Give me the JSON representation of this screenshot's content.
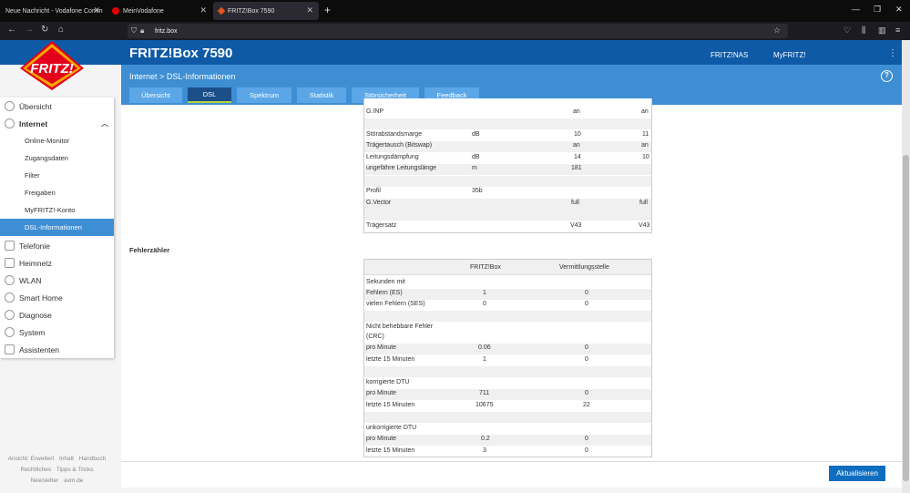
{
  "browser": {
    "tabs": [
      {
        "title": "Neue Nachricht - Vodafone Comm",
        "active": false
      },
      {
        "title": "MeinVodafone",
        "active": false
      },
      {
        "title": "FRITZ!Box 7590",
        "active": true
      }
    ],
    "url": "fritz.box"
  },
  "header": {
    "logo_text": "FRITZ!",
    "title": "FRITZ!Box 7590",
    "links": [
      "FRITZ!NAS",
      "MyFRITZ!"
    ]
  },
  "breadcrumb": {
    "parent": "Internet",
    "separator": ">",
    "current": "DSL-Informationen"
  },
  "page_tabs": [
    {
      "label": "Übersicht",
      "active": false
    },
    {
      "label": "DSL",
      "active": true
    },
    {
      "label": "Spektrum",
      "active": false
    },
    {
      "label": "Statistik",
      "active": false
    },
    {
      "label": "Störsicherheit",
      "active": false
    },
    {
      "label": "Feedback",
      "active": false
    }
  ],
  "sidebar": {
    "items": [
      {
        "label": "Übersicht"
      },
      {
        "label": "Internet"
      },
      {
        "label": "Online-Monitor"
      },
      {
        "label": "Zugangsdaten"
      },
      {
        "label": "Filter"
      },
      {
        "label": "Freigaben"
      },
      {
        "label": "MyFRITZ!-Konto"
      },
      {
        "label": "DSL-Informationen"
      },
      {
        "label": "Telefonie"
      },
      {
        "label": "Heimnetz"
      },
      {
        "label": "WLAN"
      },
      {
        "label": "Smart Home"
      },
      {
        "label": "Diagnose"
      },
      {
        "label": "System"
      },
      {
        "label": "Assistenten"
      }
    ],
    "footer": [
      "Ansicht: Erweitert",
      "Inhalt",
      "Handbuch",
      "Rechtliches",
      "Tipps & Tricks",
      "Newsletter",
      "avm.de"
    ]
  },
  "dsl_table": {
    "rows": [
      {
        "label": "G.INP",
        "unit": "",
        "down": "an",
        "up": "an"
      },
      {
        "label": "Störabstandsmarge",
        "unit": "dB",
        "down": "10",
        "up": "11"
      },
      {
        "label": "Trägertausch (Bitswap)",
        "unit": "",
        "down": "an",
        "up": "an"
      },
      {
        "label": "Leitungsdämpfung",
        "unit": "dB",
        "down": "14",
        "up": "10"
      },
      {
        "label": "ungefähre Leitungslänge",
        "unit": "m",
        "down": "181",
        "up": ""
      },
      {
        "label": "Profil",
        "unit": "35b",
        "down": "",
        "up": ""
      },
      {
        "label": "G.Vector",
        "unit": "",
        "down": "full",
        "up": "full"
      },
      {
        "label": "Trägersatz",
        "unit": "",
        "down": "V43",
        "up": "V43"
      }
    ]
  },
  "error_counter": {
    "title": "Fehlerzähler",
    "headers": [
      "",
      "FRITZ!Box",
      "Vermittlungsstelle"
    ],
    "rows": [
      {
        "label": "Sekunden mit",
        "a": "",
        "b": ""
      },
      {
        "label": "Fehlern (ES)",
        "a": "1",
        "b": "0"
      },
      {
        "label": "vielen Fehlern (SES)",
        "a": "0",
        "b": "0"
      },
      {
        "label": "Nicht behebbare Fehler",
        "a": "",
        "b": ""
      },
      {
        "label": "(CRC)",
        "a": "",
        "b": ""
      },
      {
        "label": "pro Minute",
        "a": "0.06",
        "b": "0"
      },
      {
        "label": "letzte 15 Minuten",
        "a": "1",
        "b": "0"
      },
      {
        "label": "korrigierte DTU",
        "a": "",
        "b": ""
      },
      {
        "label": "pro Minute",
        "a": "711",
        "b": "0"
      },
      {
        "label": "letzte 15 Minuten",
        "a": "10675",
        "b": "22"
      },
      {
        "label": "unkorrigierte DTU",
        "a": "",
        "b": ""
      },
      {
        "label": "pro Minute",
        "a": "0.2",
        "b": "0"
      },
      {
        "label": "letzte 15 Minuten",
        "a": "3",
        "b": "0"
      }
    ]
  },
  "actions": {
    "refresh_label": "Aktualisieren"
  },
  "colors": {
    "brand_blue": "#0e5aa7",
    "sub_blue": "#3e8ed4",
    "accent_green": "#b3d43b"
  }
}
